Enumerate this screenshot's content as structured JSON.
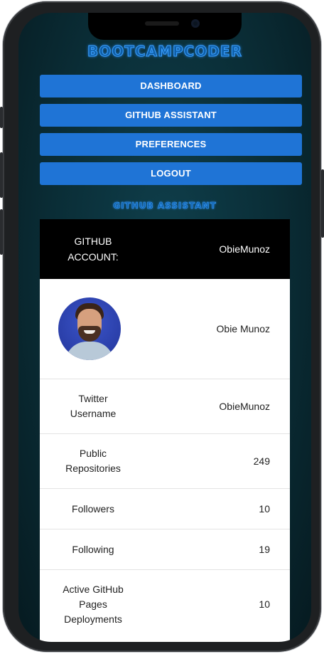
{
  "app": {
    "brand": "BOOTCAMPCODER"
  },
  "nav": {
    "items": [
      {
        "label": "DASHBOARD"
      },
      {
        "label": "GITHUB ASSISTANT"
      },
      {
        "label": "PREFERENCES"
      },
      {
        "label": "LOGOUT"
      }
    ]
  },
  "section": {
    "title": "GITHUB ASSISTANT"
  },
  "profile": {
    "header": {
      "label_line1": "GITHUB",
      "label_line2": "ACCOUNT:",
      "value": "ObieMunoz"
    },
    "name": "Obie Munoz",
    "rows": [
      {
        "label_line1": "Twitter",
        "label_line2": "Username",
        "value": "ObieMunoz"
      },
      {
        "label_line1": "Public",
        "label_line2": "Repositories",
        "value": "249"
      },
      {
        "label": "Followers",
        "value": "10"
      },
      {
        "label": "Following",
        "value": "19"
      },
      {
        "label_line1": "Active GitHub",
        "label_line2": "Pages",
        "label_line3": "Deployments",
        "value": "10"
      }
    ]
  },
  "colors": {
    "accent": "#1f74d6",
    "background": "#0a2d36",
    "header_bg": "#000000"
  },
  "icons": {
    "avatar": "profile-photo"
  }
}
